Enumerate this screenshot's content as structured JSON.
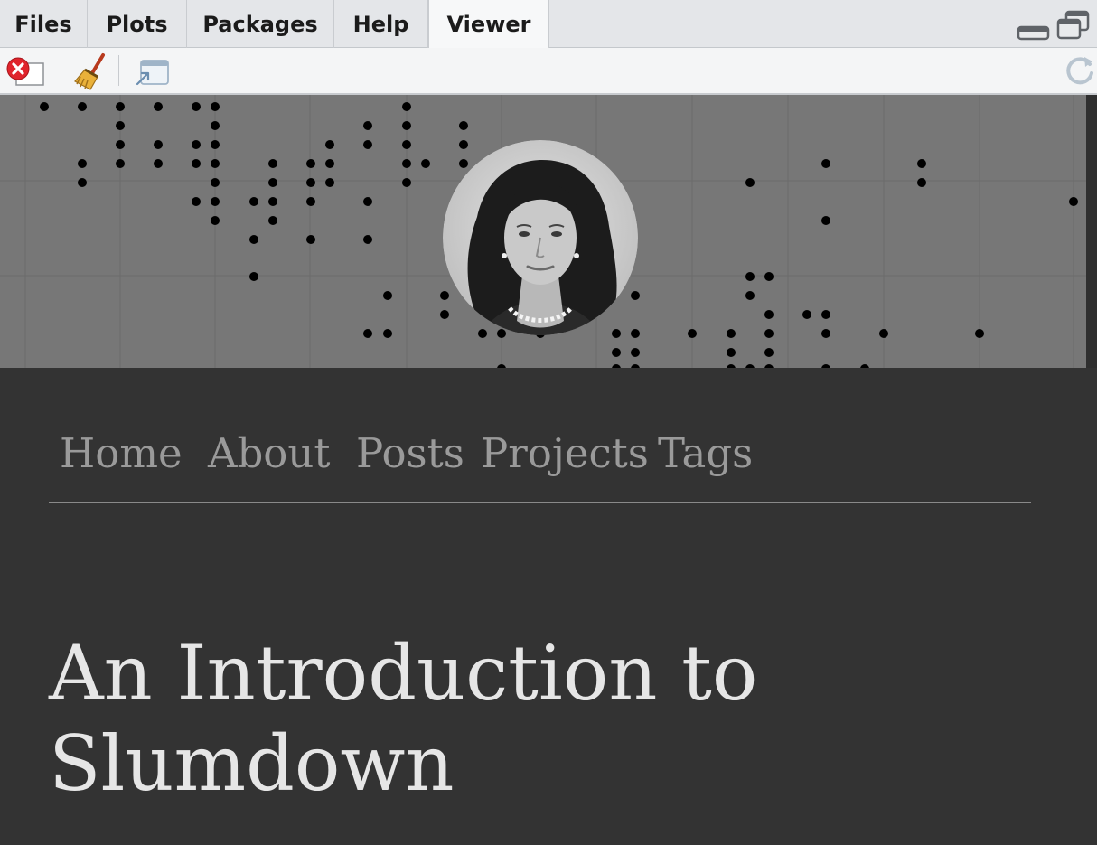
{
  "tabs": [
    {
      "label": "Files",
      "active": false
    },
    {
      "label": "Plots",
      "active": false
    },
    {
      "label": "Packages",
      "active": false
    },
    {
      "label": "Help",
      "active": false
    },
    {
      "label": "Viewer",
      "active": true
    }
  ],
  "toolbar": {
    "icons": [
      "stop-icon",
      "broom-icon",
      "show-in-window-icon",
      "refresh-icon"
    ]
  },
  "site": {
    "nav": [
      "Home",
      "About",
      "Posts",
      "Projects",
      "Tags"
    ],
    "title_line1": "An Introduction to",
    "title_line2": "Slumdown"
  },
  "colors": {
    "page_bg": "#333333",
    "hero_bg": "#777777",
    "nav_text": "#9a9a9a",
    "title_text": "#e6e6e6"
  }
}
